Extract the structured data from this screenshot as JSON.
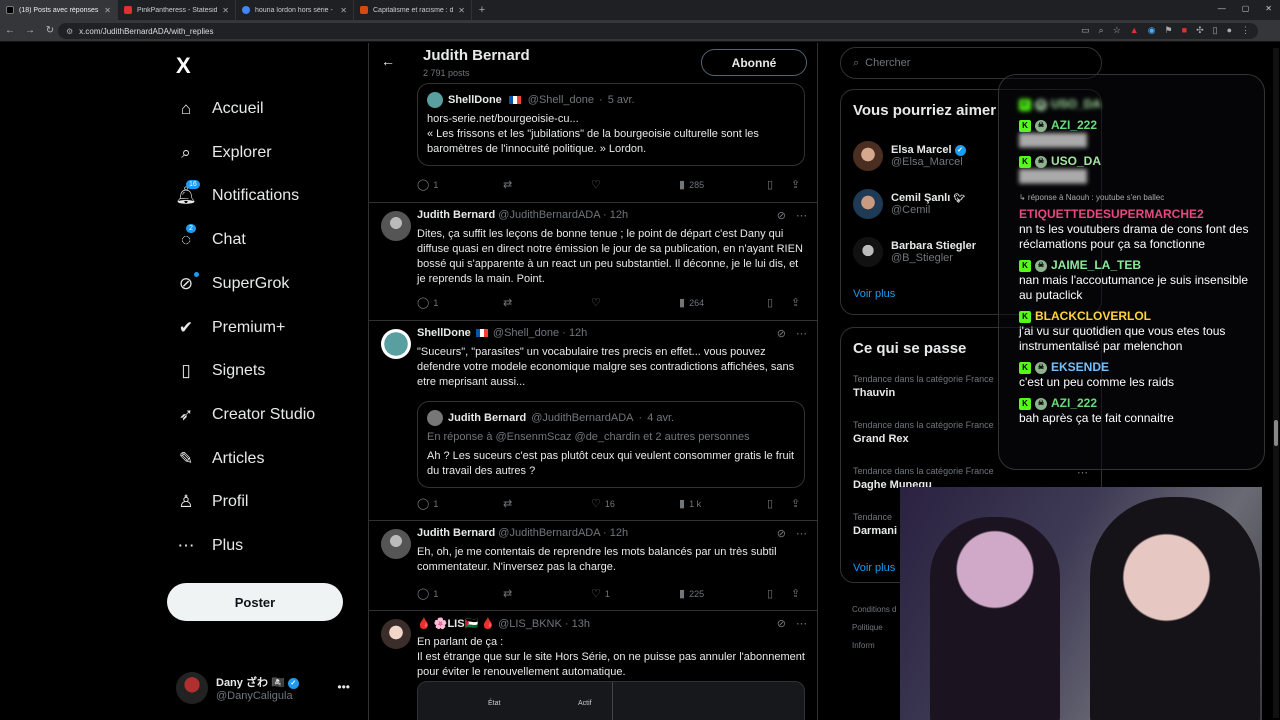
{
  "browser": {
    "tabs": [
      {
        "title": "(18) Posts avec réponses de Judith",
        "color": "#222222"
      },
      {
        "title": "PinkPantheress - Stateside + Z",
        "color": "#e03131"
      },
      {
        "title": "houria lordon hors série - Rech",
        "color": "#4285f4"
      },
      {
        "title": "Capitalisme et racisme : d'une",
        "color": "#d9480f"
      }
    ],
    "url": "x.com/JudithBernardADA/with_replies"
  },
  "sidebar": {
    "logo": "X",
    "items": [
      {
        "label": "Accueil",
        "icon": "home-icon"
      },
      {
        "label": "Explorer",
        "icon": "search-icon"
      },
      {
        "label": "Notifications",
        "icon": "bell-icon",
        "badge": "16"
      },
      {
        "label": "Chat",
        "icon": "chat-icon",
        "badge": "2"
      },
      {
        "label": "SuperGrok",
        "icon": "grok-icon"
      },
      {
        "label": "Premium+",
        "icon": "premium-icon"
      },
      {
        "label": "Signets",
        "icon": "bookmark-icon"
      },
      {
        "label": "Creator Studio",
        "icon": "rocket-icon"
      },
      {
        "label": "Articles",
        "icon": "article-icon"
      },
      {
        "label": "Profil",
        "icon": "profile-icon"
      },
      {
        "label": "Plus",
        "icon": "more-circle-icon"
      }
    ],
    "post_button": "Poster",
    "account": {
      "name": "Dany ざわ 🏴‍☠️",
      "handle": "@DanyCaligula"
    }
  },
  "header": {
    "title": "Judith Bernard",
    "posts_count": "2 791 posts",
    "follow_label": "Abonné"
  },
  "posts": [
    {
      "quote": {
        "author": "ShellDone",
        "handle": "@Shell_done",
        "time": "5 avr.",
        "text1": "hors-serie.net/bourgeoisie-cu...",
        "text2": "« Les frissons et les \"jubilations\" de la bourgeoisie culturelle sont les baromètres de l'innocuité politique. » Lordon."
      },
      "replies": "1",
      "retweets": "",
      "likes": "",
      "views": "285"
    },
    {
      "author": "Judith Bernard",
      "handle": "@JudithBernardADA",
      "time": "12h",
      "text": "Dites, ça suffit les leçons de bonne tenue ; le point de départ c'est Dany qui diffuse quasi en direct notre émission le jour de sa publication, en n'ayant RIEN bossé qui s'apparente à un react un peu substantiel. Il déconne, je le lui dis, et je reprends la main. Point.",
      "replies": "1",
      "retweets": "",
      "likes": "",
      "views": "264"
    },
    {
      "author": "ShellDone",
      "handle": "@Shell_done",
      "time": "12h",
      "text": "\"Suceurs\", \"parasites\" un vocabulaire tres precis en effet... vous pouvez defendre votre modele economique malgre ses contradictions affichées, sans etre meprisant aussi...",
      "quote": {
        "author": "Judith Bernard",
        "handle": "@JudithBernardADA",
        "time": "4 avr.",
        "reply_to": "En réponse à @EnsenmScaz @de_chardin  et 2 autres personnes",
        "text": "Ah ? Les suceurs c'est pas plutôt ceux qui veulent consommer gratis le fruit du travail des autres ?"
      },
      "replies": "1",
      "retweets": "",
      "likes": "16",
      "views": "1 k"
    },
    {
      "author": "Judith Bernard",
      "handle": "@JudithBernardADA",
      "time": "12h",
      "text": "Eh, oh, je me contentais de reprendre les mots balancés par un très subtil commentateur. N'inversez pas la charge.",
      "replies": "1",
      "retweets": "",
      "likes": "1",
      "views": "225"
    },
    {
      "author": "🩸 🌸LIS🇵🇸 🩸",
      "handle": "@LIS_BKNK",
      "time": "13h",
      "text": "En parlant de ça :\nIl est étrange que sur le site Hors Série, on ne puisse pas annuler l'abonnement pour éviter le renouvellement automatique.",
      "preview": {
        "col1": "État",
        "col2": "Actif"
      }
    }
  ],
  "right": {
    "search_placeholder": "Chercher",
    "suggest_title": "Vous pourriez aimer",
    "suggestions": [
      {
        "name": "Elsa Marcel",
        "handle": "@Elsa_Marcel"
      },
      {
        "name": "Cemil Şanlı",
        "handle": "@Cemil"
      },
      {
        "name": "Barbara Stiegler",
        "handle": "@B_Stiegler"
      }
    ],
    "see_more": "Voir plus",
    "trends_title": "Ce qui se passe",
    "trends": [
      {
        "category": "Tendance dans la catégorie France",
        "name": "Thauvin"
      },
      {
        "category": "Tendance dans la catégorie France",
        "name": "Grand Rex"
      },
      {
        "category": "Tendance dans la catégorie France",
        "name": "Daghe Munegu"
      },
      {
        "category": "Tendance",
        "name": "Darmani"
      }
    ],
    "see_more_trends": "Voir plus",
    "legal": [
      "Conditions d",
      "Politique",
      "Inform"
    ]
  },
  "chat_overlay": {
    "messages": [
      {
        "user": "USO_DA",
        "color": "#a6e3a1",
        "text": ""
      },
      {
        "user": "AZI_222",
        "color": "#69db7c",
        "text": ""
      },
      {
        "user": "USO_DA",
        "color": "#a6e3a1",
        "text": ""
      },
      {
        "reply_note": "↳ réponse à Naouh : youtube s'en ballec",
        "user": "ETIQUETTEDESUPERMARCHE2",
        "color": "#e64980",
        "text": "nn ts les voutubers drama de cons font des réclamations pour ça sa fonctionne"
      },
      {
        "user": "JAIME_LA_TEB",
        "color": "#8ce99a",
        "text": "nan mais l'accoutumance je suis insensible au putaclick"
      },
      {
        "user": "BLACKCLOVERLOL",
        "color": "#ffd43b",
        "text": "j'ai vu sur quotidien que vous etes tous instrumentalisé par melenchon"
      },
      {
        "user": "EKSENDE",
        "color": "#74c0fc",
        "text": "c'est un peu comme les raids"
      },
      {
        "user": "AZI_222",
        "color": "#69db7c",
        "text": "bah après ça te fait connaitre"
      }
    ]
  }
}
